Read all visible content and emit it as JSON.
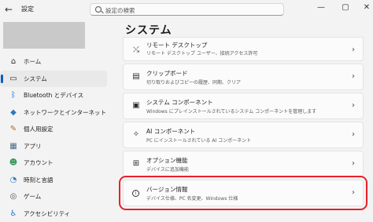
{
  "titlebar": {
    "back_icon": "←",
    "app_title": "設定",
    "search_placeholder": "設定の検索",
    "controls": [
      "—",
      "▢",
      "✕"
    ]
  },
  "sidebar": {
    "items": [
      {
        "icon": "⌂",
        "label": "ホーム",
        "active": false
      },
      {
        "icon": "▭",
        "label": "システム",
        "active": true
      },
      {
        "icon": "ᛒ",
        "label": "Bluetooth とデバイス",
        "active": false
      },
      {
        "icon": "◆",
        "label": "ネットワークとインターネット",
        "active": false
      },
      {
        "icon": "✎",
        "label": "個人用設定",
        "active": false
      },
      {
        "icon": "▦",
        "label": "アプリ",
        "active": false
      },
      {
        "icon": "☻",
        "label": "アカウント",
        "active": false
      },
      {
        "icon": "◔",
        "label": "時刻と言語",
        "active": false
      },
      {
        "icon": "◎",
        "label": "ゲーム",
        "active": false
      },
      {
        "icon": "♿",
        "label": "アクセシビリティ",
        "active": false
      }
    ]
  },
  "main": {
    "title": "システム",
    "cards": [
      {
        "icon": "⤯",
        "title": "リモート デスクトップ",
        "desc": "リモート デスクトップ ユーザー、接続アクセス許可"
      },
      {
        "icon": "▤",
        "title": "クリップボード",
        "desc": "切り取りおよびコピーの履歴、同期、クリア"
      },
      {
        "icon": "▣",
        "title": "システム コンポーネント",
        "desc": "Windows にプレインストールされているシステム コンポーネントを管理します"
      },
      {
        "icon": "✧",
        "title": "AI コンポーネント",
        "desc": "PC にインストールされている AI コンポーネント"
      },
      {
        "icon": "⊞",
        "title": "オプション機能",
        "desc": "デバイスに追加機能"
      },
      {
        "icon": "i",
        "title": "バージョン情報",
        "desc": "デバイス仕様、PC 名変更、Windows 仕様"
      }
    ],
    "chevron": "›"
  },
  "colors": {
    "accent": "#005fb8",
    "highlight": "#e8202a"
  }
}
